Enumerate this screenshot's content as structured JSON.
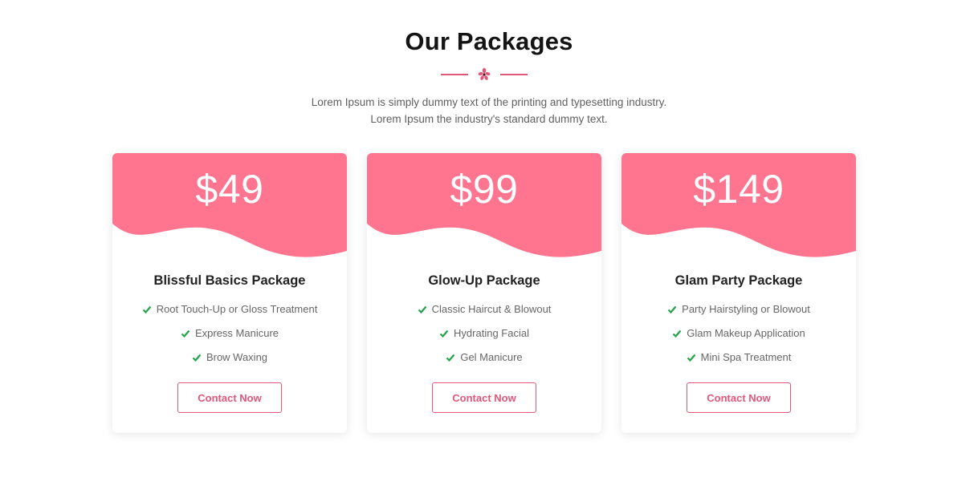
{
  "section": {
    "title": "Our Packages",
    "intro_line_1": "Lorem Ipsum is simply dummy text of the printing and typesetting industry.",
    "intro_line_2": "Lorem Ipsum the industry's standard dummy text.",
    "divider_icon": "flower-ornament-icon"
  },
  "colors": {
    "accent": "#ff7590",
    "button_border": "#e0577a",
    "button_text": "#e0577a",
    "check": "#23a34a",
    "divider": "#e0577a"
  },
  "packages": [
    {
      "price": "$49",
      "name": "Blissful Basics Package",
      "features": [
        "Root Touch-Up or Gloss Treatment",
        "Express Manicure",
        "Brow Waxing"
      ],
      "button_label": "Contact Now"
    },
    {
      "price": "$99",
      "name": "Glow-Up Package",
      "features": [
        "Classic Haircut & Blowout",
        "Hydrating Facial",
        "Gel Manicure"
      ],
      "button_label": "Contact Now"
    },
    {
      "price": "$149",
      "name": "Glam Party Package",
      "features": [
        "Party Hairstyling or Blowout",
        "Glam Makeup Application",
        "Mini Spa Treatment"
      ],
      "button_label": "Contact Now"
    }
  ]
}
